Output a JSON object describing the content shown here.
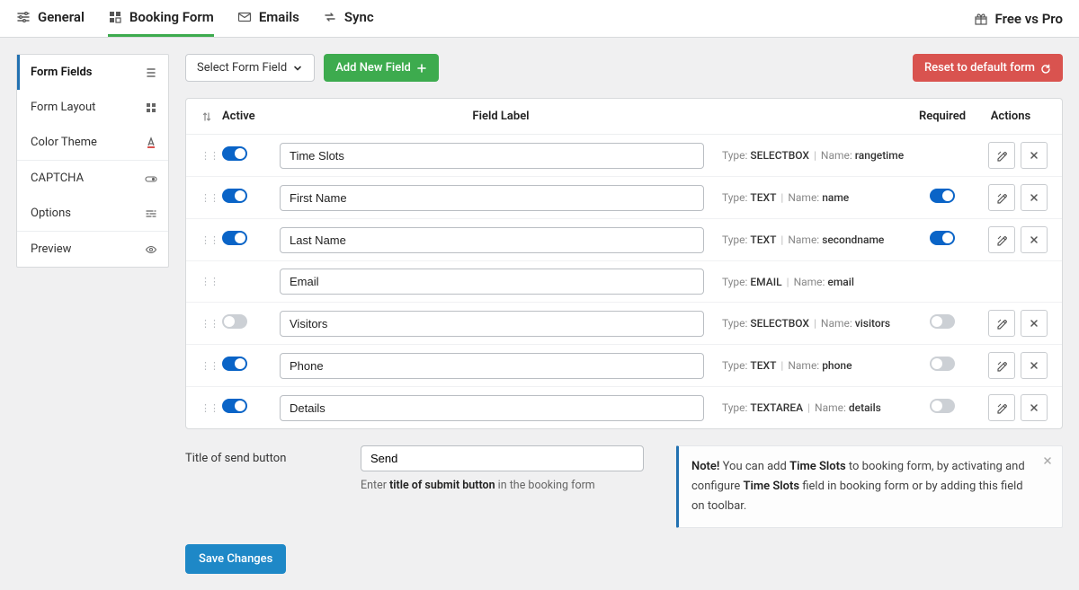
{
  "topTabs": {
    "general": "General",
    "booking": "Booking Form",
    "emails": "Emails",
    "sync": "Sync",
    "freepro": "Free vs Pro"
  },
  "sidebar": {
    "items": [
      {
        "label": "Form Fields",
        "icon": "list"
      },
      {
        "label": "Form Layout",
        "icon": "grid"
      },
      {
        "label": "Color Theme",
        "icon": "font-color"
      },
      {
        "label": "CAPTCHA",
        "icon": "toggle"
      },
      {
        "label": "Options",
        "icon": "sliders"
      },
      {
        "label": "Preview",
        "icon": "eye"
      }
    ]
  },
  "toolbar": {
    "select": "Select Form Field",
    "add": "Add New Field",
    "reset": "Reset to default form"
  },
  "table": {
    "headers": {
      "active": "Active",
      "label": "Field Label",
      "required": "Required",
      "actions": "Actions"
    },
    "typeLabel": "Type:",
    "nameLabel": "Name:"
  },
  "fields": [
    {
      "active": true,
      "label": "Time Slots",
      "type": "SELECTBOX",
      "name": "rangetime",
      "required": null,
      "actions": true
    },
    {
      "active": true,
      "label": "First Name",
      "type": "TEXT",
      "name": "name",
      "required": true,
      "actions": true
    },
    {
      "active": true,
      "label": "Last Name",
      "type": "TEXT",
      "name": "secondname",
      "required": true,
      "actions": true
    },
    {
      "active": null,
      "label": "Email",
      "type": "EMAIL",
      "name": "email",
      "required": null,
      "actions": false
    },
    {
      "active": false,
      "label": "Visitors",
      "type": "SELECTBOX",
      "name": "visitors",
      "required": false,
      "actions": true
    },
    {
      "active": true,
      "label": "Phone",
      "type": "TEXT",
      "name": "phone",
      "required": false,
      "actions": true
    },
    {
      "active": true,
      "label": "Details",
      "type": "TEXTAREA",
      "name": "details",
      "required": false,
      "actions": true
    }
  ],
  "sendTitle": {
    "label": "Title of send button",
    "value": "Send",
    "helpPrefix": "Enter ",
    "helpBold": "title of submit button",
    "helpSuffix": " in the booking form"
  },
  "note": {
    "bold1": "Note!",
    "t1": " You can add ",
    "bold2": "Time Slots",
    "t2": " to booking form, by activating and configure ",
    "bold3": "Time Slots",
    "t3": " field in booking form or by adding this field on toolbar."
  },
  "save": "Save Changes"
}
